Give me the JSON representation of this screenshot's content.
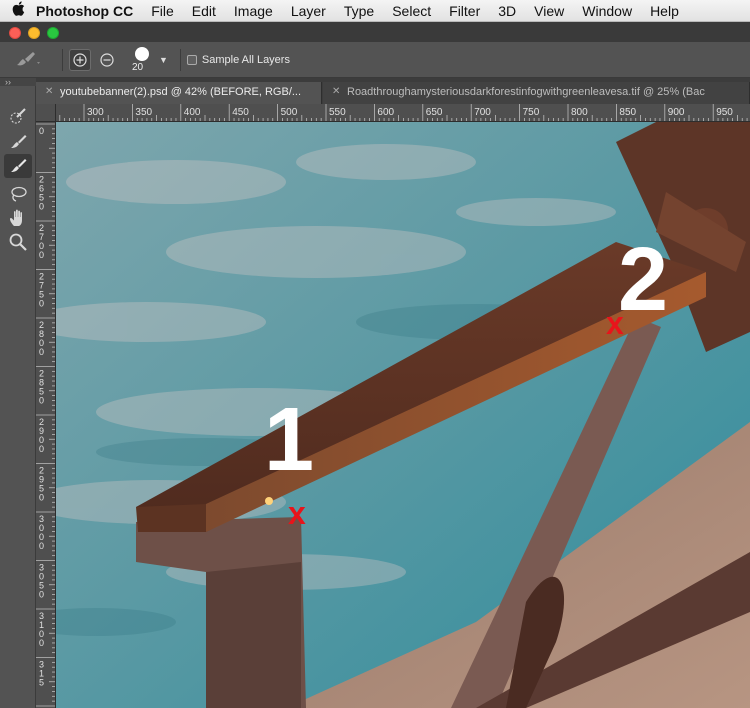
{
  "menubar": {
    "app_name": "Photoshop CC",
    "items": [
      "File",
      "Edit",
      "Image",
      "Layer",
      "Type",
      "Select",
      "Filter",
      "3D",
      "View",
      "Window",
      "Help"
    ]
  },
  "options_bar": {
    "brush_size": "20",
    "sample_all_layers_label": "Sample All Layers",
    "sample_all_layers_checked": false
  },
  "tabs": [
    {
      "label": "youtubebanner(2).psd @ 42% (BEFORE, RGB/...",
      "active": true
    },
    {
      "label": "Roadthroughamysteriousdarkforestinfogwithgreenleavesa.tif @ 25% (Bac",
      "active": false
    }
  ],
  "ruler_h_labels": [
    "300",
    "350",
    "400",
    "450",
    "500",
    "550",
    "600",
    "650",
    "700",
    "750",
    "800",
    "850",
    "900",
    "950"
  ],
  "ruler_v_labels": [
    "0",
    "2\n6\n5\n0",
    "2\n7\n0\n0",
    "2\n7\n5\n0",
    "2\n8\n0\n0",
    "2\n8\n5\n0",
    "2\n9\n0\n0",
    "2\n9\n5\n0",
    "3\n0\n0\n0",
    "3\n0\n5\n0",
    "3\n1\n0\n0",
    "3\n1\n5"
  ],
  "tools": [
    "quick-selection-icon",
    "quick-selection-add-icon",
    "quick-selection-subtract-icon",
    "lasso-icon",
    "hand-icon",
    "zoom-icon"
  ],
  "annotations": [
    {
      "number": "1",
      "marker": "x"
    },
    {
      "number": "2",
      "marker": "x"
    }
  ],
  "colors": {
    "marker": "#e8141b",
    "annotation_number": "#ffffff",
    "ui_dark": "#535353"
  }
}
